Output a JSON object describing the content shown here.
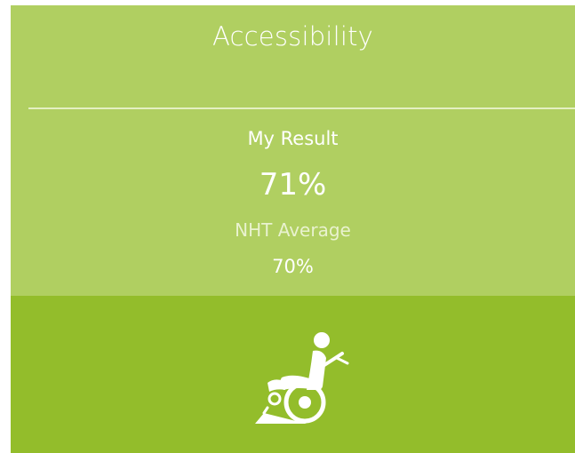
{
  "card": {
    "title": "Accessibility",
    "my_result_label": "My Result",
    "my_result_value": "71%",
    "average_label": "NHT Average",
    "average_value": "70%",
    "icon": "wheelchair-ramp-icon",
    "colors": {
      "top_background": "#b0cf61",
      "icon_band_background": "#93bd2b",
      "text": "#ffffff"
    }
  }
}
